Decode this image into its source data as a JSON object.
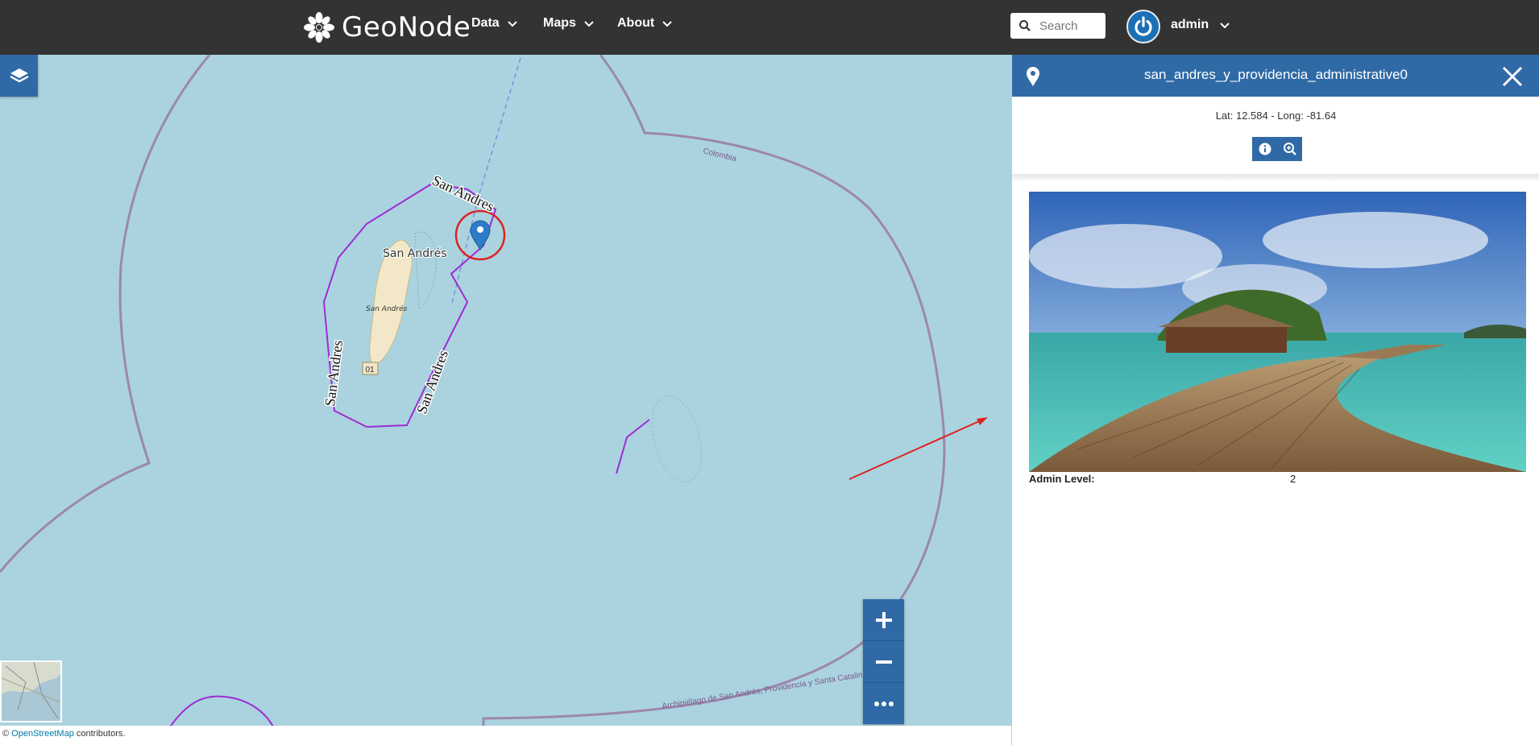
{
  "header": {
    "brand": "GeoNode",
    "nav": [
      {
        "label": "Data"
      },
      {
        "label": "Maps"
      },
      {
        "label": "About"
      }
    ],
    "search_placeholder": "Search",
    "user": "admin"
  },
  "map": {
    "labels": {
      "colombia": "Colombia",
      "san_andres_border_top": "San Andres",
      "san_andres_border_left": "San Andres",
      "san_andres_border_right": "San Andres",
      "island_name": "San Andrés",
      "island_small": "San Andrés",
      "road_shield": "01",
      "archipelago": "Archipiélago de San Andrés, Providencia y Santa Catalina"
    },
    "zoom": {
      "in": "+",
      "out": "−",
      "more": "•••"
    },
    "attribution": {
      "prefix": "© ",
      "link": "OpenStreetMap",
      "suffix": " contributors."
    }
  },
  "panel": {
    "title": "san_andres_y_providencia_administrative0",
    "coords": "Lat: 12.584 - Long: -81.64",
    "attributes": [
      {
        "key": "Admin Level:",
        "value": "2"
      }
    ]
  },
  "colors": {
    "header_bg": "#333333",
    "accent": "#2f6aa6",
    "water": "#aad3df",
    "admin_boundary": "#9e2bd6",
    "border_line": "#9a7ea6"
  }
}
